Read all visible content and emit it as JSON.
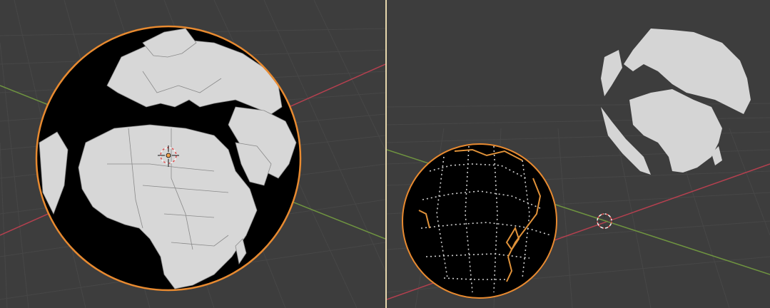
{
  "viewports": [
    {
      "id": "left",
      "label": "",
      "object": "earth-sphere-selected"
    },
    {
      "id": "right",
      "label": "",
      "objects": [
        "earth-sphere-selected-wireframe",
        "earth-land-mesh"
      ]
    }
  ],
  "colors": {
    "viewport_bg": "#3d3d3d",
    "grid_line": "#4a4a4a",
    "axis_x": "#c44a5a",
    "axis_y": "#7ea04a",
    "selection_outline": "#f0a04a",
    "land": "#d8d8d8",
    "ocean": "#000000",
    "divider": "#e6d6ac",
    "cursor": "#e05050"
  },
  "icons": [
    "3d-cursor-icon",
    "origin-point-icon"
  ]
}
